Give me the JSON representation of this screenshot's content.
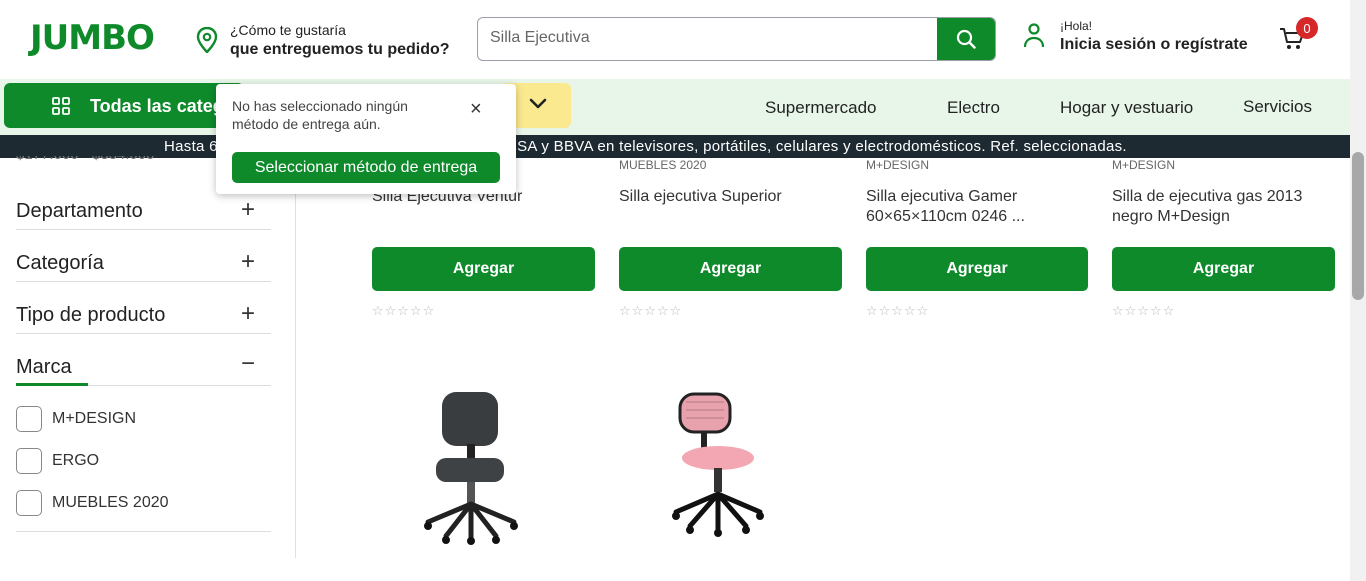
{
  "header": {
    "logo": "JUMBO",
    "delivery_line1": "¿Cómo te gustaría",
    "delivery_line2": "que entreguemos tu pedido?",
    "search_value": "Silla Ejecutiva",
    "greeting": "¡Hola!",
    "login": "Inicia sesión o regístrate",
    "cart_count": "0"
  },
  "nav": {
    "all_categories": "Todas las categorías",
    "links": [
      "Supermercado",
      "Electro",
      "Hogar y vestuario",
      "Servicios"
    ]
  },
  "promo": {
    "left": "Hasta 6",
    "right": "NSA y BBVA en televisores, portátiles, celulares y electrodomésticos. Ref. seleccionadas."
  },
  "popover": {
    "message": "No has seleccionado ningún método de entrega aún.",
    "button": "Seleccionar método de entrega"
  },
  "filters": {
    "price_partial": "$177.000 - $334.000",
    "sections": [
      "Departamento",
      "Categoría",
      "Tipo de producto",
      "Marca"
    ],
    "brand_options": [
      "M+DESIGN",
      "ERGO",
      "MUEBLES 2020"
    ]
  },
  "products": [
    {
      "brand": "",
      "name": "Silla Ejecutiva Ventur",
      "button": "Agregar",
      "stars": "☆☆☆☆☆"
    },
    {
      "brand": "MUEBLES 2020",
      "name": "Silla ejecutiva Superior",
      "button": "Agregar",
      "stars": "☆☆☆☆☆"
    },
    {
      "brand": "M+DESIGN",
      "name": "Silla ejecutiva Gamer 60×65×110cm 0246 ...",
      "button": "Agregar",
      "stars": "☆☆☆☆☆"
    },
    {
      "brand": "M+DESIGN",
      "name": "Silla de ejecutiva gas 2013 negro M+Design",
      "button": "Agregar",
      "stars": "☆☆☆☆☆"
    }
  ],
  "colors": {
    "brand_green": "#0e8a2b",
    "nav_bg": "#e8f6e9",
    "promo_bg": "#1e2a32",
    "badge_red": "#d62828",
    "yellow": "#fbe98f"
  }
}
